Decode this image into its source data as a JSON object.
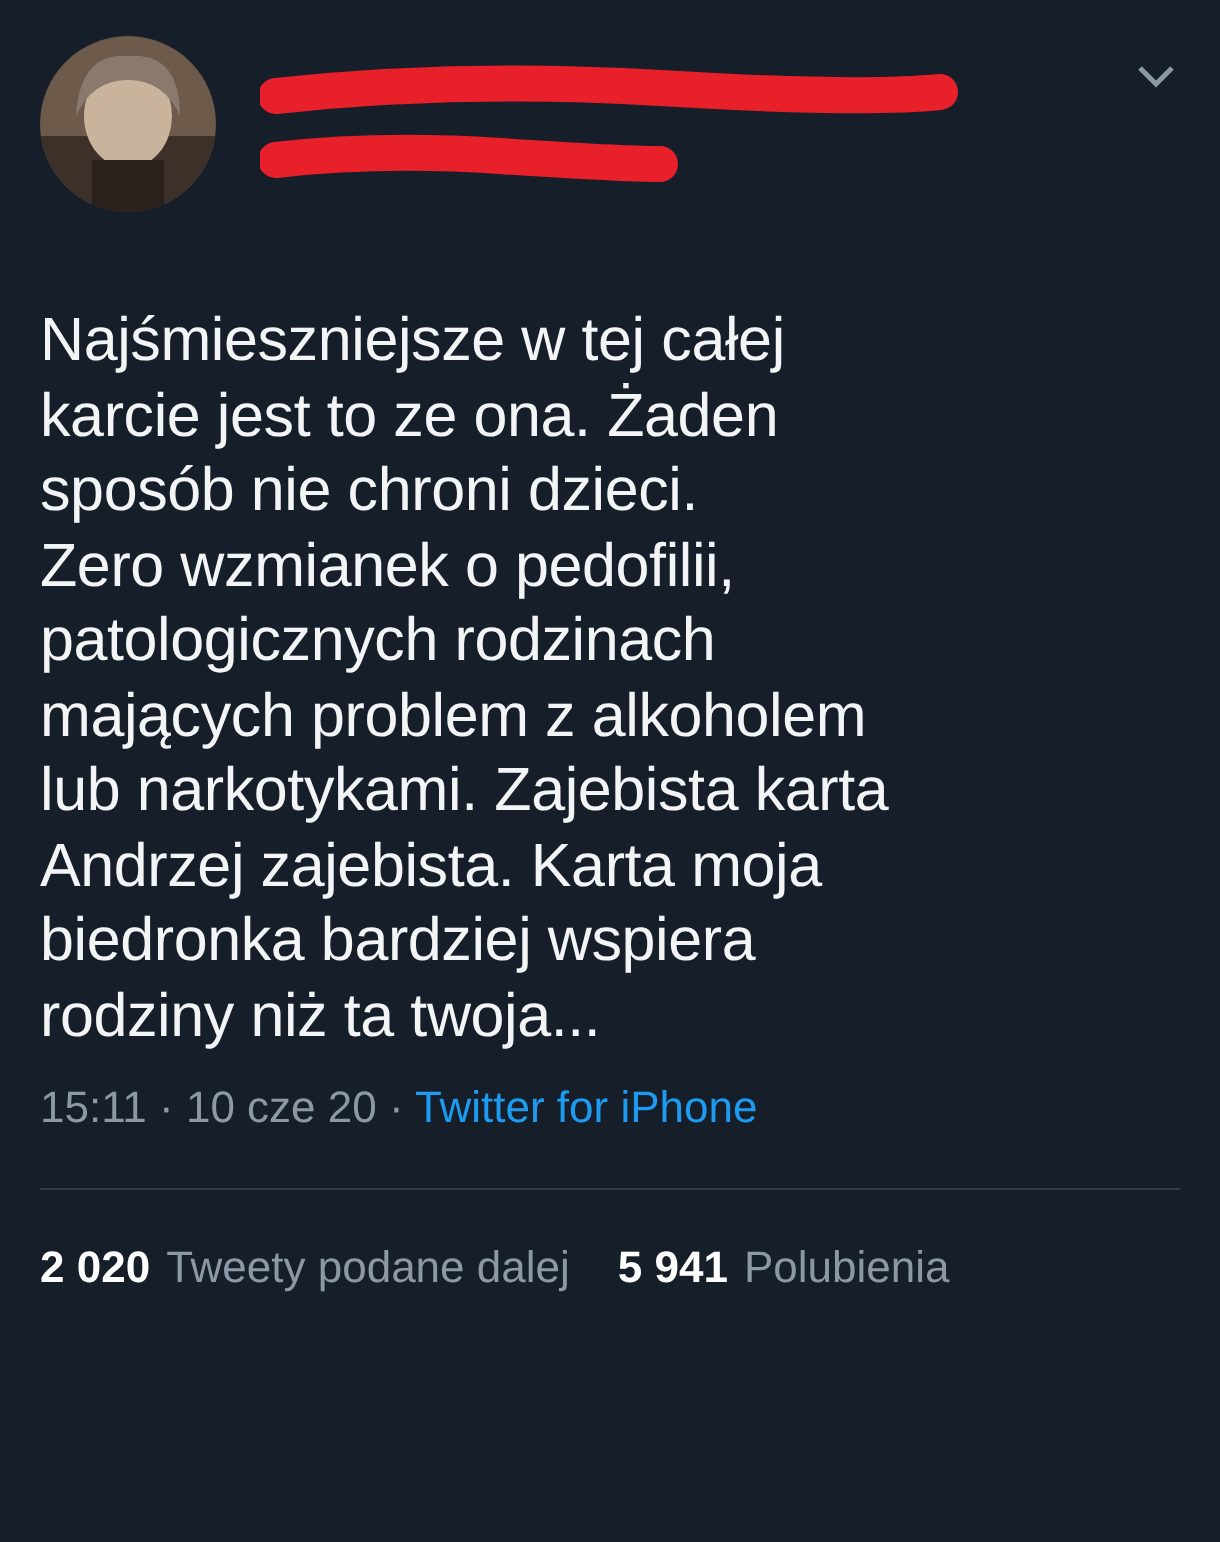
{
  "tweet": {
    "text": "Najśmieszniejsze w tej całej\nkarcie jest to ze ona. Żaden\nsposób nie chroni dzieci.\nZero wzmianek o pedofilii,\npatologicznych rodzinach\nmających problem z alkoholem\nlub narkotykami. Zajebista karta\nAndrzej zajebista. Karta moja\nbiedronka bardziej wspiera\nrodziny niż ta twoja...",
    "time": "15:11 · 10 cze 20 · ",
    "source": "Twitter for iPhone"
  },
  "stats": [
    {
      "count": "2 020",
      "label": "Tweety podane dalej"
    },
    {
      "count": "5 941",
      "label": "Polubienia"
    }
  ]
}
